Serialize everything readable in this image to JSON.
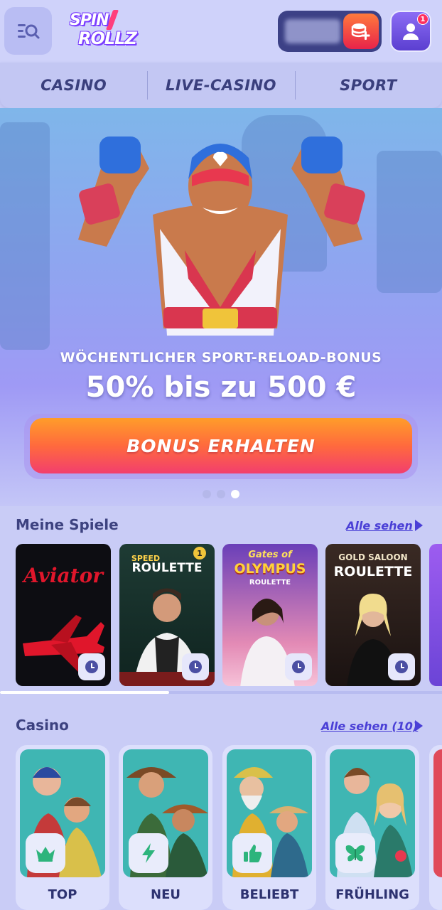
{
  "header": {
    "logo_line1": "SPIN",
    "logo_line2": "ROLLZ",
    "notification_count": "1"
  },
  "tabs": [
    {
      "label": "CASINO"
    },
    {
      "label": "LIVE-CASINO"
    },
    {
      "label": "SPORT"
    }
  ],
  "hero": {
    "title": "WÖCHENTLICHER SPORT-RELOAD-BONUS",
    "subtitle": "50% bis zu 500 €",
    "button_label": "BONUS ERHALTEN",
    "slides_total": 3,
    "active_slide": 3
  },
  "my_games": {
    "title": "Meine Spiele",
    "see_all": "Alle sehen",
    "games": [
      {
        "name": "Aviator"
      },
      {
        "name": "ROULETTE",
        "pretitle": "SPEED",
        "badge": "1"
      },
      {
        "name": "OLYMPUS",
        "pretitle": "Gates of",
        "subtitle": "ROULETTE"
      },
      {
        "name": "ROULETTE",
        "pretitle": "GOLD SALOON"
      }
    ]
  },
  "casino": {
    "title": "Casino",
    "see_all": "Alle sehen (10)",
    "categories": [
      {
        "label": "TOP",
        "icon": "crown-icon"
      },
      {
        "label": "NEU",
        "icon": "lightning-icon"
      },
      {
        "label": "BELIEBT",
        "icon": "thumbs-up-icon"
      },
      {
        "label": "FRÜHLING",
        "icon": "butterfly-icon"
      }
    ]
  },
  "colors": {
    "accent": "#4a3fd6",
    "button_start": "#ff9d2a",
    "button_end": "#f23e6e",
    "background": "#c9ccf6"
  }
}
